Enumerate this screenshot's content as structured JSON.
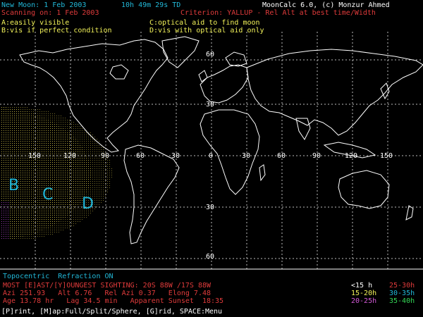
{
  "header": {
    "new_moon": "New Moon: 1 Feb 2003",
    "time": "10h 49m 29s TD",
    "scanning": "Scanning on: 1 Feb 2003",
    "app": "MoonCalc 6.0, (c) Monzur Ahmed",
    "criterion": "Criterion: YALLUP - Rel Alt at best time/Width"
  },
  "legend_abcd": {
    "a": "A:easily visible",
    "b": "B:vis if perfect condition",
    "c": "C:optical aid to find moon",
    "d": "D:vis with optical aid only"
  },
  "grid_labels": {
    "lat_top_60": "60",
    "lat_top_30": "30",
    "lat_bottom_30": "30",
    "lat_bottom_60": "60",
    "lon_150w": "150",
    "lon_120w": "120",
    "lon_90w": "90",
    "lon_60w": "60",
    "lon_30w": "30",
    "lon_0": "0",
    "lon_30e": "30",
    "lon_60e": "60",
    "lon_90e": "90",
    "lon_120e": "120",
    "lon_150e": "150"
  },
  "zones": {
    "b": "B",
    "c": "C",
    "d": "D"
  },
  "status": {
    "topocentric": "Topocentric  Refraction ON",
    "sighting": "MOST [E]AST/[Y]OUNGEST SIGHTING: 20S 88W /17S 88W",
    "line1": "Azi 251.93   Alt 6.76   Rel Azi 0.37   Elong 7.48",
    "line2": "Age 13.78 hr   Lag 34.5 min   Apparent Sunset  18:35"
  },
  "hours_legend": {
    "h1": "<15 h",
    "h2": "25-30h",
    "h3": "15-20h",
    "h4": "30-35h",
    "h5": "20-25h",
    "h6": "35-40h"
  },
  "menu": "[P]rint, [M]ap:Full/Split/Sphere, [G]rid, SPACE:Menu",
  "colors": {
    "text_cyan": "#22b8d8",
    "text_red": "#e03b3b",
    "text_yellow": "#f3f35a",
    "text_white": "#ffffff",
    "text_magenta": "#d35ad8",
    "text_green": "#34d856",
    "zone_yellow": "#d8c84a",
    "zone_magenta": "#b64ad0"
  }
}
